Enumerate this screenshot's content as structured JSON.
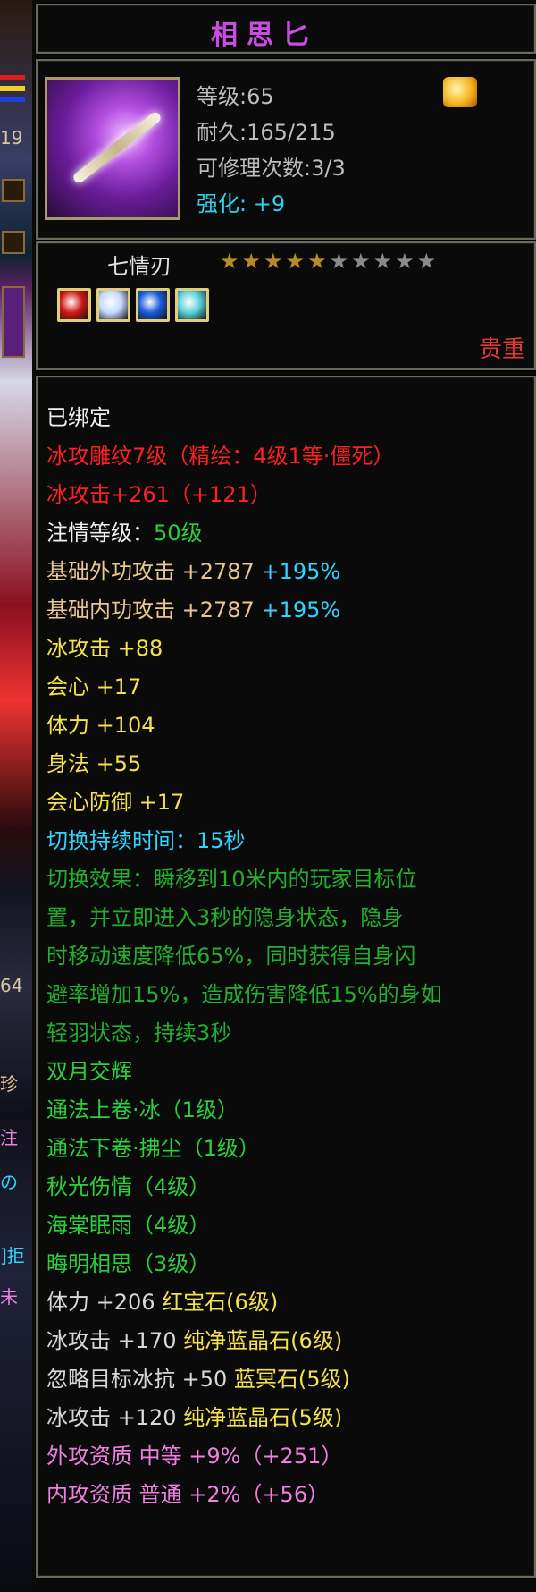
{
  "scene": {
    "number_1": "19",
    "number_2": "64",
    "char_1": "珍",
    "char_2": "注",
    "char_3": "の",
    "char_4": "]拒",
    "char_5": "未"
  },
  "item": {
    "title": "相思匕",
    "level": "等级:65",
    "durability": "耐久:165/215",
    "repairs": "可修理次数:3/3",
    "enhance_label": "强化:",
    "enhance_value": "+9",
    "weapon_type": "七情刃",
    "stars_filled": 5,
    "stars_total": 10,
    "rarity": "贵重"
  },
  "gems": [
    {
      "name": "red-gem",
      "color": "#d01818"
    },
    {
      "name": "white-blue-gem",
      "color": "#c8d8ff"
    },
    {
      "name": "blue-gem",
      "color": "#1a5ad8"
    },
    {
      "name": "teal-gem",
      "color": "#5ad0d8"
    }
  ],
  "lines": [
    {
      "parts": [
        {
          "text": "已绑定",
          "c": "white"
        }
      ]
    },
    {
      "parts": [
        {
          "text": "冰攻雕纹7级（精绘：4级1等·僵死）",
          "c": "red"
        }
      ]
    },
    {
      "parts": [
        {
          "text": "冰攻击+261（+121）",
          "c": "red"
        }
      ]
    },
    {
      "parts": [
        {
          "text": "注情等级：",
          "c": "white"
        },
        {
          "text": "50级",
          "c": "green"
        }
      ]
    },
    {
      "parts": [
        {
          "text": "基础外功攻击 +2787 ",
          "c": "tan"
        },
        {
          "text": "+195%",
          "c": "cyan"
        }
      ]
    },
    {
      "parts": [
        {
          "text": "基础内功攻击 +2787 ",
          "c": "tan"
        },
        {
          "text": "+195%",
          "c": "cyan"
        }
      ]
    },
    {
      "parts": [
        {
          "text": "冰攻击 +88",
          "c": "yellow"
        }
      ]
    },
    {
      "parts": [
        {
          "text": "会心 +17",
          "c": "yellow"
        }
      ]
    },
    {
      "parts": [
        {
          "text": "体力 +104",
          "c": "yellow"
        }
      ]
    },
    {
      "parts": [
        {
          "text": "身法 +55",
          "c": "yellow"
        }
      ]
    },
    {
      "parts": [
        {
          "text": "会心防御 +17",
          "c": "yellow"
        }
      ]
    },
    {
      "parts": [
        {
          "text": "切换持续时间：15秒",
          "c": "cyan"
        }
      ]
    },
    {
      "parts": [
        {
          "text": "切换效果：瞬移到10米内的玩家目标位",
          "c": "dgreen"
        }
      ]
    },
    {
      "parts": [
        {
          "text": "置，并立即进入3秒的隐身状态，隐身",
          "c": "dgreen"
        }
      ]
    },
    {
      "parts": [
        {
          "text": "时移动速度降低65%，同时获得自身闪",
          "c": "dgreen"
        }
      ]
    },
    {
      "parts": [
        {
          "text": "避率增加15%，造成伤害降低15%的身如",
          "c": "dgreen"
        }
      ]
    },
    {
      "parts": [
        {
          "text": "轻羽状态，持续3秒",
          "c": "dgreen"
        }
      ]
    },
    {
      "parts": [
        {
          "text": "双月交辉",
          "c": "green"
        }
      ]
    },
    {
      "parts": [
        {
          "text": "通法上卷·冰（1级）",
          "c": "green"
        }
      ]
    },
    {
      "parts": [
        {
          "text": "通法下卷·拂尘（1级）",
          "c": "green"
        }
      ]
    },
    {
      "parts": [
        {
          "text": "秋光伤情（4级）",
          "c": "green"
        }
      ]
    },
    {
      "parts": [
        {
          "text": "海棠眠雨（4级）",
          "c": "green"
        }
      ]
    },
    {
      "parts": [
        {
          "text": "晦明相思（3级）",
          "c": "green"
        }
      ]
    },
    {
      "parts": [
        {
          "text": "体力 +206 ",
          "c": "gray"
        },
        {
          "text": "红宝石(6级)",
          "c": "yellow"
        }
      ]
    },
    {
      "parts": [
        {
          "text": "冰攻击 +170 ",
          "c": "gray"
        },
        {
          "text": "纯净蓝晶石(6级)",
          "c": "yellow"
        }
      ]
    },
    {
      "parts": [
        {
          "text": "忽略目标冰抗 +50 ",
          "c": "gray"
        },
        {
          "text": "蓝冥石(5级)",
          "c": "yellow"
        }
      ]
    },
    {
      "parts": [
        {
          "text": "冰攻击 +120 ",
          "c": "gray"
        },
        {
          "text": "纯净蓝晶石(5级)",
          "c": "yellow"
        }
      ]
    },
    {
      "parts": [
        {
          "text": "外攻资质  中等 +9%（+251）",
          "c": "pink"
        }
      ]
    },
    {
      "parts": [
        {
          "text": "内攻资质  普通 +2%（+56）",
          "c": "pink"
        }
      ]
    }
  ]
}
